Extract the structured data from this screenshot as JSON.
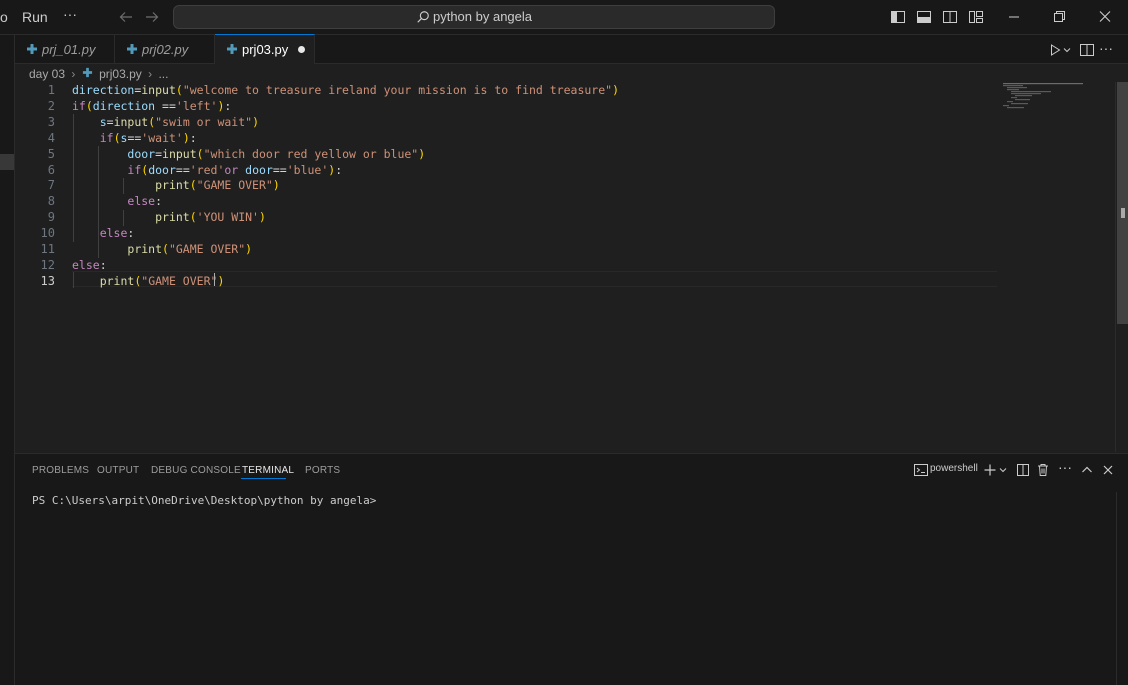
{
  "titlebar": {
    "menu_partial": "o",
    "menu_run": "Run",
    "menu_more": "···",
    "search_text": "python by angela"
  },
  "tabs": [
    {
      "label": "prj_01.py",
      "active": false
    },
    {
      "label": "prj02.py",
      "active": false
    },
    {
      "label": "prj03.py",
      "active": true,
      "dirty": true
    }
  ],
  "breadcrumb": {
    "folder": "day 03",
    "file": "prj03.py",
    "more": "..."
  },
  "editor": {
    "line_numbers": [
      "1",
      "2",
      "3",
      "4",
      "5",
      "6",
      "7",
      "8",
      "9",
      "10",
      "11",
      "12",
      "13"
    ],
    "current_line": "13",
    "lines": [
      "direction=input(\"welcome to treasure ireland your mission is to find treasure\")",
      "if(direction =='left'):",
      "    s=input(\"swim or wait\")",
      "    if(s=='wait'):",
      "        door=input(\"which door red yellow or blue\")",
      "        if(door=='red'or door=='blue'):",
      "            print(\"GAME OVER\")",
      "        else:",
      "            print('YOU WIN')",
      "    else:",
      "        print(\"GAME OVER\")",
      "else:",
      "    print(\"GAME OVER\")"
    ]
  },
  "panel": {
    "tabs": [
      "PROBLEMS",
      "OUTPUT",
      "DEBUG CONSOLE",
      "TERMINAL",
      "PORTS"
    ],
    "active_tab": "TERMINAL",
    "shell": "powershell",
    "terminal_prompt": "PS C:\\Users\\arpit\\OneDrive\\Desktop\\python by angela>"
  },
  "colors": {
    "accent": "#0078d4",
    "keyword": "#c586c0",
    "variable": "#9cdcfe",
    "function": "#dcdcaa",
    "string": "#ce9178",
    "bracket_gold": "#ffd700",
    "bracket_orchid": "#da70d6",
    "python_icon": "#519aba"
  }
}
